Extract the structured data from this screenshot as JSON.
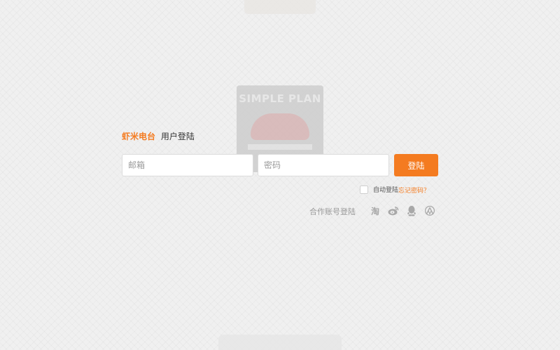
{
  "background": {
    "album_title": "SIMPLE PLAN"
  },
  "login": {
    "brand": "虾米电台",
    "title": "用户登陆",
    "email_placeholder": "邮箱",
    "password_placeholder": "密码",
    "submit_label": "登陆",
    "auto_login_label": "自动登陆",
    "forgot_password_label": "忘记密码？",
    "partner_label": "合作账号登陆",
    "partner_icons": [
      "taobao-icon",
      "weibo-icon",
      "qq-icon",
      "renren-icon"
    ],
    "taobao_glyph": "淘"
  },
  "colors": {
    "accent": "#f47b20",
    "background": "#f0f0f0",
    "icon_gray": "#a8a8a8"
  }
}
